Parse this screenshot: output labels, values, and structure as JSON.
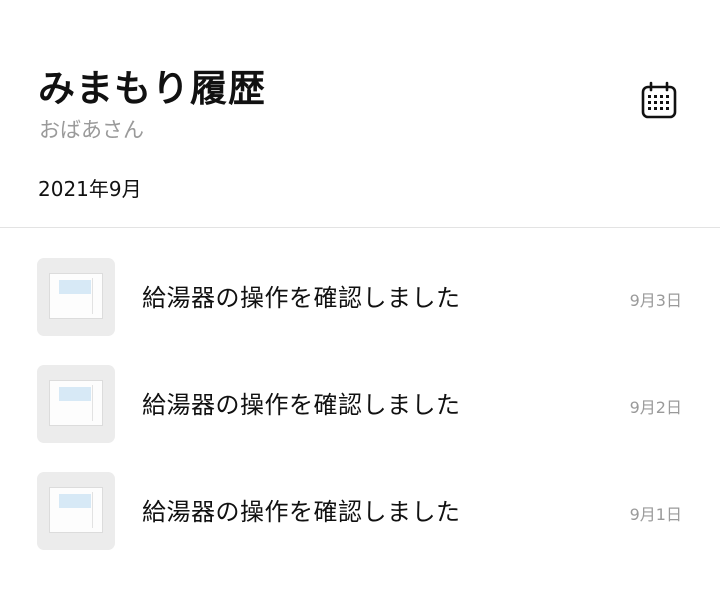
{
  "header": {
    "title": "みまもり履歴",
    "subtitle": "おばあさん",
    "month": "2021年9月",
    "calendar_icon": "calendar-icon"
  },
  "history": [
    {
      "text": "給湯器の操作を確認しました",
      "date": "9月3日",
      "icon": "water-heater-panel-icon"
    },
    {
      "text": "給湯器の操作を確認しました",
      "date": "9月2日",
      "icon": "water-heater-panel-icon"
    },
    {
      "text": "給湯器の操作を確認しました",
      "date": "9月1日",
      "icon": "water-heater-panel-icon"
    }
  ]
}
